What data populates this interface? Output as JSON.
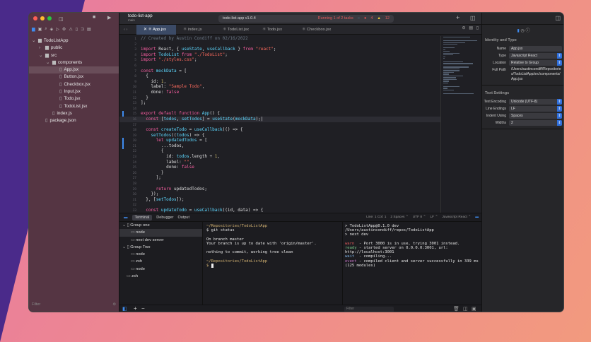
{
  "window": {
    "project": "todo-list-app",
    "branch": "main",
    "scheme": "todo-list-app v1.0.4",
    "status": "Running 1 of 2 tasks",
    "errors": "4",
    "warnings": "12"
  },
  "colors": {
    "accent": "#3f8cf0",
    "keyword": "#fc5fa3",
    "string": "#fc6a5d",
    "type": "#5dd8ff"
  },
  "navigator": {
    "items": [
      {
        "label": "TodoListApp",
        "icon": "folder-icon",
        "depth": 0,
        "expanded": true
      },
      {
        "label": "public",
        "icon": "folder-icon",
        "depth": 1,
        "expanded": false
      },
      {
        "label": "src",
        "icon": "folder-icon",
        "depth": 1,
        "expanded": true
      },
      {
        "label": "components",
        "icon": "folder-icon",
        "depth": 2,
        "expanded": true
      },
      {
        "label": "App.jsx",
        "icon": "file-icon",
        "depth": 3,
        "selected": true
      },
      {
        "label": "Button.jsx",
        "icon": "file-icon",
        "depth": 3
      },
      {
        "label": "Checkbox.jsx",
        "icon": "file-icon",
        "depth": 3
      },
      {
        "label": "Input.jsx",
        "icon": "file-icon",
        "depth": 3
      },
      {
        "label": "Todo.jsx",
        "icon": "file-icon",
        "depth": 3
      },
      {
        "label": "TodoList.jsx",
        "icon": "file-icon",
        "depth": 3
      },
      {
        "label": "index.js",
        "icon": "file-icon",
        "depth": 2
      },
      {
        "label": "package.json",
        "icon": "file-icon",
        "depth": 1
      }
    ],
    "filter_placeholder": "Filter"
  },
  "tabs": [
    "App.jsx",
    "index.js",
    "TodoList.jsx",
    "Todo.jsx",
    "Checkbox.jsx"
  ],
  "code": [
    [
      [
        "// Created by Austin Condiff on 02/16/2022",
        "c"
      ]
    ],
    [],
    [
      [
        "import ",
        "k"
      ],
      [
        "React, { ",
        "p"
      ],
      [
        "useState",
        "t"
      ],
      [
        ", ",
        "p"
      ],
      [
        "useCallback",
        "t"
      ],
      [
        " } ",
        "p"
      ],
      [
        "from ",
        "k"
      ],
      [
        "\"react\"",
        "s"
      ],
      [
        ";",
        "p"
      ]
    ],
    [
      [
        "import ",
        "k"
      ],
      [
        "TodoList ",
        "t"
      ],
      [
        "from ",
        "k"
      ],
      [
        "\"./TodoList\"",
        "s"
      ],
      [
        ";",
        "p"
      ]
    ],
    [
      [
        "import ",
        "k"
      ],
      [
        "\"./styles.css\"",
        "s"
      ],
      [
        ";",
        "p"
      ]
    ],
    [],
    [
      [
        "const ",
        "k"
      ],
      [
        "mockData",
        "t"
      ],
      [
        " = [",
        "p"
      ]
    ],
    [
      [
        "  {",
        "p"
      ]
    ],
    [
      [
        "    id: ",
        "p"
      ],
      [
        "1",
        "nm"
      ],
      [
        ",",
        "p"
      ]
    ],
    [
      [
        "    label: ",
        "p"
      ],
      [
        "\"Sample Todo\"",
        "s"
      ],
      [
        ",",
        "p"
      ]
    ],
    [
      [
        "    done: ",
        "p"
      ],
      [
        "false",
        "k"
      ]
    ],
    [
      [
        "  }",
        "p"
      ]
    ],
    [
      [
        "];",
        "p"
      ]
    ],
    [],
    [
      [
        "export default function ",
        "k"
      ],
      [
        "App",
        "t"
      ],
      [
        "() {",
        "p"
      ]
    ],
    [
      [
        "  const ",
        "k"
      ],
      [
        "[",
        "p"
      ],
      [
        "todos",
        "t"
      ],
      [
        ", ",
        "p"
      ],
      [
        "setTodos",
        "t"
      ],
      [
        "] = ",
        "p"
      ],
      [
        "useState",
        "t"
      ],
      [
        "(",
        "p"
      ],
      [
        "mockData",
        "t"
      ],
      [
        ");",
        "p"
      ]
    ],
    [],
    [
      [
        "  const ",
        "k"
      ],
      [
        "createTodo",
        "t"
      ],
      [
        " = ",
        "p"
      ],
      [
        "useCallback",
        "t"
      ],
      [
        "(() => {",
        "p"
      ]
    ],
    [
      [
        "    setTodos",
        "t"
      ],
      [
        "((",
        "p"
      ],
      [
        "todos",
        "t"
      ],
      [
        ") => {",
        "p"
      ]
    ],
    [
      [
        "      let ",
        "k"
      ],
      [
        "updatedTodos",
        "t"
      ],
      [
        " = [",
        "p"
      ]
    ],
    [
      [
        "        ...todos,",
        "p"
      ]
    ],
    [
      [
        "        {",
        "p"
      ]
    ],
    [
      [
        "          id: ",
        "p"
      ],
      [
        "todos",
        "t"
      ],
      [
        ".length + ",
        "p"
      ],
      [
        "1",
        "nm"
      ],
      [
        ",",
        "p"
      ]
    ],
    [
      [
        "          label: ",
        "p"
      ],
      [
        "\"\"",
        "s"
      ],
      [
        ",",
        "p"
      ]
    ],
    [
      [
        "          done: ",
        "p"
      ],
      [
        "false",
        "k"
      ]
    ],
    [
      [
        "        }",
        "p"
      ]
    ],
    [
      [
        "      ];",
        "p"
      ]
    ],
    [],
    [
      [
        "      return ",
        "k"
      ],
      [
        "updatedTodos;",
        "p"
      ]
    ],
    [
      [
        "    });",
        "p"
      ]
    ],
    [
      [
        "  }, [",
        "p"
      ],
      [
        "setTodos",
        "t"
      ],
      [
        "]);",
        "p"
      ]
    ],
    [],
    [
      [
        "  const ",
        "k"
      ],
      [
        "updateTodo",
        "t"
      ],
      [
        " = ",
        "p"
      ],
      [
        "useCallback",
        "t"
      ],
      [
        "((id, data) => {",
        "p"
      ]
    ]
  ],
  "bottom": {
    "tabs": [
      "Terminal",
      "Debugger",
      "Output"
    ],
    "status": [
      "Line: 1  Col: 1",
      "2 Spaces ⌃",
      "UTF 8 ⌃",
      "LF ⌃",
      "Javascript React ⌃"
    ],
    "groups": [
      {
        "label": "Group one",
        "depth": 0,
        "group": true
      },
      {
        "label": "node",
        "depth": 1,
        "selected": true
      },
      {
        "label": "next dev server",
        "depth": 1
      },
      {
        "label": "Group Two",
        "depth": 0,
        "group": true
      },
      {
        "label": "node",
        "depth": 1
      },
      {
        "label": "zsh",
        "depth": 1
      },
      {
        "label": "node",
        "depth": 1
      },
      {
        "label": "zsh",
        "depth": 0
      }
    ],
    "term1": {
      "path": "~/Repositories/TodoListApp",
      "cmd": "$ git status",
      "out1": "On branch master",
      "out2": "Your branch is up to date with 'origin/master'.",
      "out3": "nothing to commit, working tree clean",
      "path2": "~/Repositories/TodoListApp",
      "prompt": "$ "
    },
    "term2": {
      "l1": "> TodoListApp@0.1.0 dev /Users/austincondiff/repos/TodoListApp",
      "l2": "> next dev",
      "warn": "warn",
      "warn_t": "  - Port 3000 is in use, trying 3001 instead.",
      "ready": "ready",
      "ready_t": " - started server on 0.0.0.0:3001, url: http://localhost:3001",
      "wait": "wait",
      "wait_t": "  - compiling...",
      "event": "event",
      "event_t": " - compiled client and server successfully in 339 ms (125 modules)"
    },
    "filter_placeholder": "Filter"
  },
  "inspector": {
    "identity_title": "Identity and Type",
    "name_label": "Name",
    "name": "App.jsx",
    "type_label": "Type",
    "type": "Javascript  React",
    "location_label": "Location",
    "location": "Relative to Group",
    "path_label": "Full Path",
    "path": "/Users/austincondiff/Repositories/TodoListApp/src/components/App.jsx",
    "text_title": "Text Settings",
    "enc_label": "Text Encoding",
    "enc": "Unicode (UTF-8)",
    "le_label": "Line Endings",
    "le": "LF",
    "indent_label": "Indent Using",
    "indent": "Spaces",
    "widths_label": "Widths",
    "widths": "2"
  }
}
